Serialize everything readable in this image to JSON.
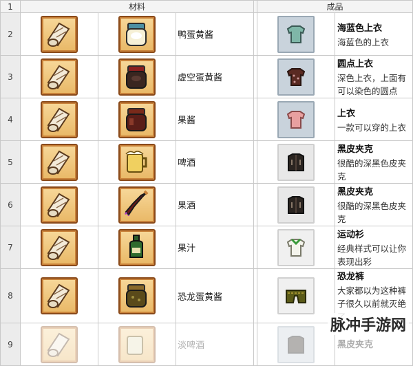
{
  "header": {
    "col_num": "1",
    "materials": "材料",
    "product": "成品"
  },
  "rows": [
    {
      "num": "2",
      "ingredient": "鸭蛋黄酱",
      "title": "海蓝色上衣",
      "desc": "海蓝色的上衣"
    },
    {
      "num": "3",
      "ingredient": "虚空蛋黄酱",
      "title": "圆点上衣",
      "desc": "深色上衣，上面有可以染色的圆点"
    },
    {
      "num": "4",
      "ingredient": "果酱",
      "title": "上衣",
      "desc": "一款可以穿的上衣"
    },
    {
      "num": "5",
      "ingredient": "啤酒",
      "title": "黑皮夹克",
      "desc": "很酷的深黑色皮夹克"
    },
    {
      "num": "6",
      "ingredient": "果酒",
      "title": "黑皮夹克",
      "desc": "很酷的深黑色皮夹克"
    },
    {
      "num": "7",
      "ingredient": "果汁",
      "title": "运动衫",
      "desc": "经典样式可以让你表现出彩"
    },
    {
      "num": "8",
      "ingredient": "恐龙蛋黄酱",
      "title": "恐龙裤",
      "desc": "大家都以为这种裤子很久以前就灭绝了"
    },
    {
      "num": "9",
      "ingredient": "淡啤酒",
      "title": "黑皮夹克",
      "desc": ""
    }
  ],
  "watermark": "脉冲手游网",
  "icons": {
    "cloth": "cloth-roll-icon",
    "items": [
      "duck-mayonnaise-jar-icon",
      "void-mayonnaise-jar-icon",
      "jelly-jar-icon",
      "beer-mug-icon",
      "wine-bottle-icon",
      "juice-bottle-icon",
      "dinosaur-mayonnaise-jar-icon",
      "pale-ale-icon"
    ],
    "products": [
      "sea-blue-shirt-icon",
      "dotted-shirt-icon",
      "pink-shirt-icon",
      "leather-jacket-icon",
      "leather-jacket-icon",
      "sport-shirt-icon",
      "dino-pants-icon",
      "leather-jacket-icon"
    ]
  }
}
